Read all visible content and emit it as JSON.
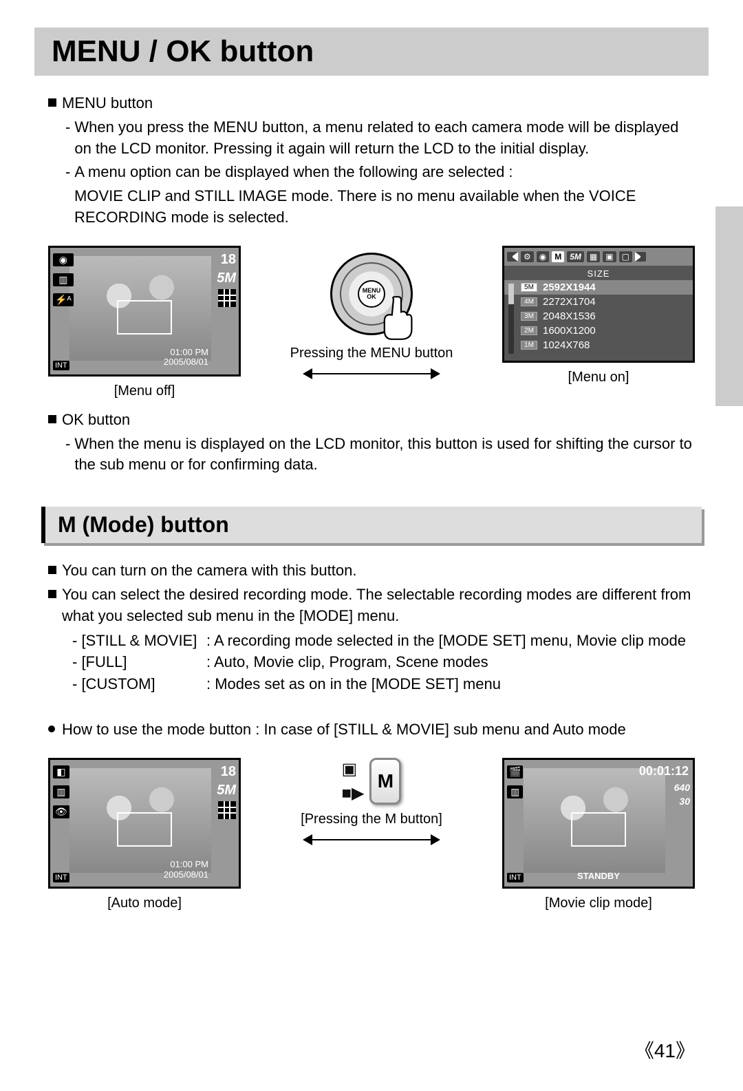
{
  "page_number": "《41》",
  "section1": {
    "title": "MENU / OK button",
    "menu_heading": "MENU button",
    "menu_p1": "When you press the MENU button, a menu related to each camera mode will be displayed on the LCD monitor. Pressing it again will return the LCD to the initial display.",
    "menu_p2a": "A menu option can be displayed when the following are selected :",
    "menu_p2b": "MOVIE CLIP and STILL IMAGE mode. There is no menu available when the VOICE RECORDING mode is selected.",
    "fig_menu_off": "[Menu off]",
    "fig_pressing_menu": "Pressing the MENU button",
    "fig_menu_on": "[Menu on]",
    "ok_heading": "OK button",
    "ok_p1": "When the menu is displayed on the LCD monitor, this button is used for shifting the cursor to the sub menu or for confirming data."
  },
  "lcd1": {
    "shots": "18",
    "size": "5M",
    "flash": "⚡ᴬ",
    "time": "01:00 PM",
    "date": "2005/08/01",
    "int": "INT"
  },
  "dial": {
    "center": "MENU OK"
  },
  "size_menu": {
    "label": "SIZE",
    "top_5m": "5M",
    "top_m": "M",
    "items": [
      {
        "badge": "5M",
        "val": "2592X1944",
        "sel": true
      },
      {
        "badge": "4M",
        "val": "2272X1704",
        "sel": false
      },
      {
        "badge": "3M",
        "val": "2048X1536",
        "sel": false
      },
      {
        "badge": "2M",
        "val": "1600X1200",
        "sel": false
      },
      {
        "badge": "1M",
        "val": "1024X768",
        "sel": false
      }
    ]
  },
  "section2": {
    "title": "M (Mode) button",
    "p1": "You can turn on the camera with this button.",
    "p2": "You can select the desired recording mode. The selectable recording modes are different from what you selected sub menu in the [MODE] menu.",
    "modes": [
      {
        "key": "- [STILL & MOVIE]",
        "desc": ": A recording mode selected in the [MODE SET] menu, Movie clip mode"
      },
      {
        "key": "- [FULL]",
        "desc": ": Auto, Movie clip, Program, Scene modes"
      },
      {
        "key": "- [CUSTOM]",
        "desc": ": Modes set as on in the [MODE SET] menu"
      }
    ],
    "howto": "How to use the mode button : In case of [STILL & MOVIE] sub menu and Auto mode",
    "fig_auto": "[Auto mode]",
    "fig_pressing_m": "[Pressing the M button]",
    "fig_movie": "[Movie clip mode]",
    "m_label": "M"
  },
  "lcd_auto": {
    "shots": "18",
    "size": "5M",
    "time": "01:00 PM",
    "date": "2005/08/01",
    "int": "INT",
    "eye": "👁"
  },
  "lcd_movie": {
    "time": "00:01:12",
    "res": "640",
    "fps": "30",
    "standby": "STANDBY",
    "int": "INT"
  }
}
